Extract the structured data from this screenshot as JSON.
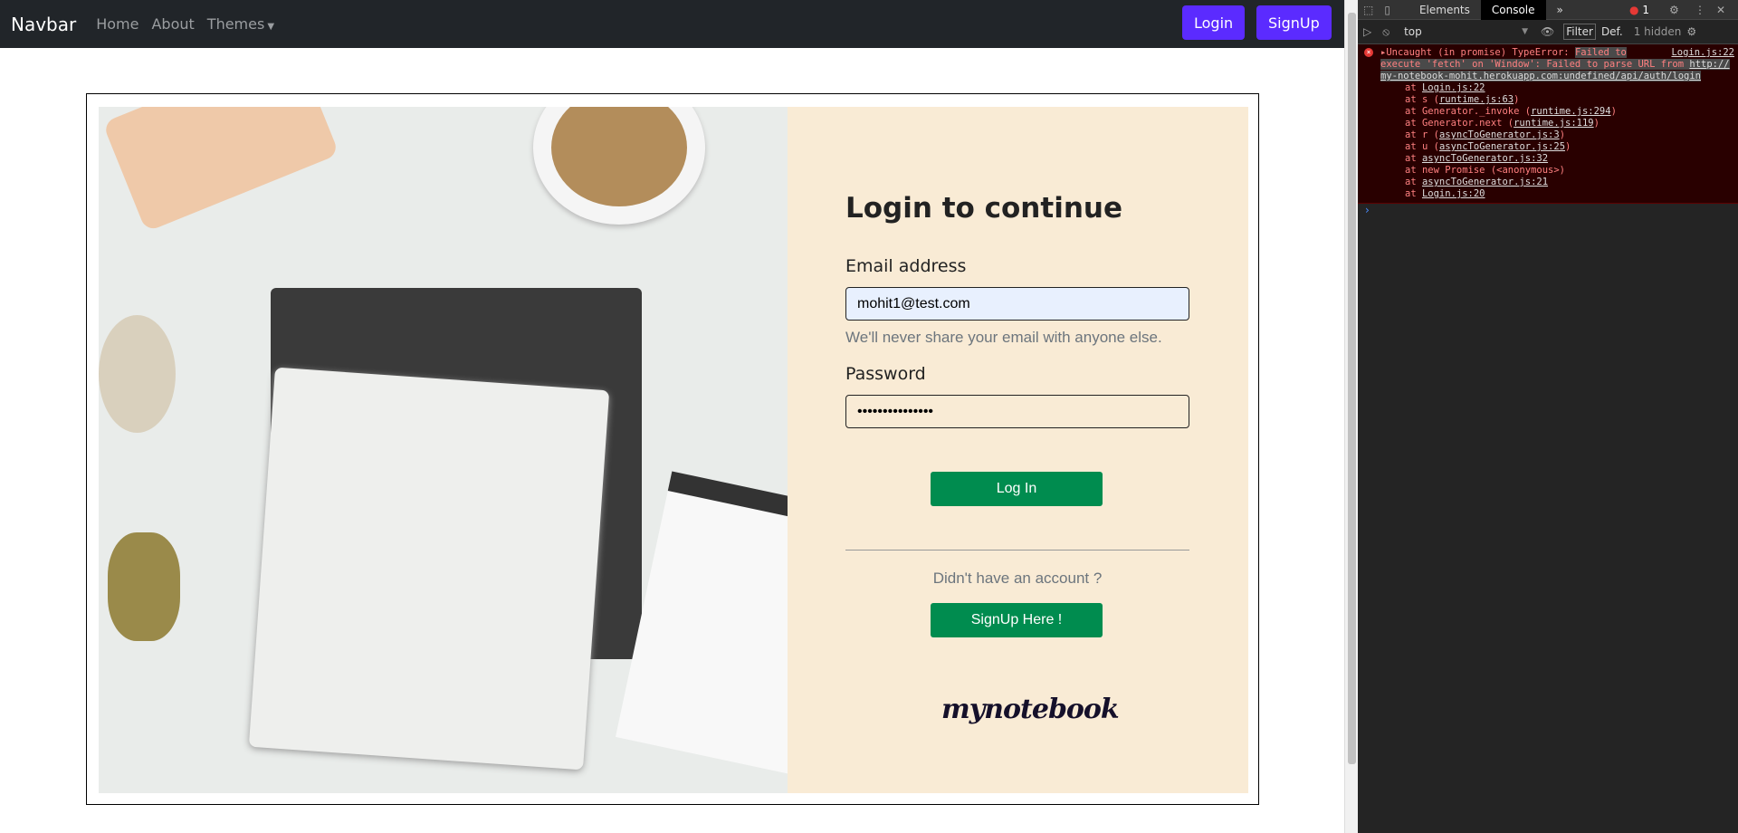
{
  "navbar": {
    "brand": "Navbar",
    "links": [
      "Home",
      "About",
      "Themes"
    ],
    "login": "Login",
    "signup": "SignUp",
    "accent": "#5b2bff"
  },
  "form": {
    "title": "Login to continue",
    "email_label": "Email address",
    "email_value": "mohit1@test.com",
    "email_hint": "We'll never share your email with anyone else.",
    "password_label": "Password",
    "password_value": "•••••••••••••••",
    "login_button": "Log In",
    "no_account": "Didn't have an account ?",
    "signup_button": "SignUp Here !",
    "logo": "mynotebook",
    "button_color": "#008c4f"
  },
  "devtools": {
    "tabs": [
      "Elements",
      "Console"
    ],
    "more": "»",
    "error_count": "1",
    "context": "top",
    "filter": "Filter",
    "levels": "Def.",
    "hidden": "1 hidden",
    "error": {
      "prefix": "Uncaught (in promise) TypeError: ",
      "highlight": "Failed to ",
      "source": "Login.js:22",
      "msg": "execute 'fetch' on 'Window': Failed to parse URL from ",
      "url": "http://my-notebook-mohit.herokuapp.com:undefined/api/auth/login",
      "stack": [
        [
          "at ",
          "Login.js:22",
          ""
        ],
        [
          "at s (",
          "runtime.js:63",
          ")"
        ],
        [
          "at Generator._invoke (",
          "runtime.js:294",
          ")"
        ],
        [
          "at Generator.next (",
          "runtime.js:119",
          ")"
        ],
        [
          "at r (",
          "asyncToGenerator.js:3",
          ")"
        ],
        [
          "at u (",
          "asyncToGenerator.js:25",
          ")"
        ],
        [
          "at ",
          "asyncToGenerator.js:32",
          ""
        ],
        [
          "at new Promise (<anonymous>)",
          "",
          ""
        ],
        [
          "at ",
          "asyncToGenerator.js:21",
          ""
        ],
        [
          "at ",
          "Login.js:20",
          ""
        ]
      ]
    }
  }
}
